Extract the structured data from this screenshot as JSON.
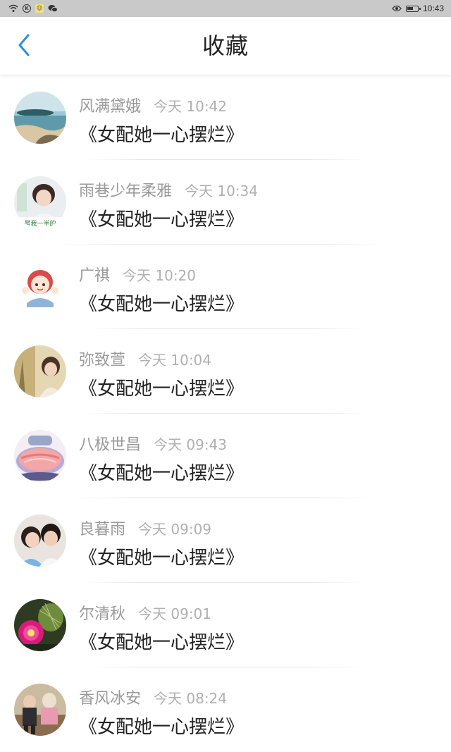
{
  "status_bar": {
    "time": "10:43",
    "left_icons": [
      "wifi-icon",
      "k-icon",
      "notification-icon",
      "wechat-icon"
    ],
    "right_icons": [
      "eye-icon",
      "battery-icon"
    ]
  },
  "header": {
    "title": "收藏",
    "back_icon": "chevron-left-icon",
    "accent_color": "#2b8fe0"
  },
  "items": [
    {
      "user": "风满黛娥",
      "time": "今天 10:42",
      "book": "《女配她一心摆烂》"
    },
    {
      "user": "雨巷少年柔雅",
      "time": "今天 10:34",
      "book": "《女配她一心摆烂》",
      "avatar_text": "是我一半的"
    },
    {
      "user": "广祺",
      "time": "今天 10:20",
      "book": "《女配她一心摆烂》"
    },
    {
      "user": "弥致萱",
      "time": "今天 10:04",
      "book": "《女配她一心摆烂》"
    },
    {
      "user": "八极世昌",
      "time": "今天 09:43",
      "book": "《女配她一心摆烂》"
    },
    {
      "user": "良暮雨",
      "time": "今天 09:09",
      "book": "《女配她一心摆烂》"
    },
    {
      "user": "尔清秋",
      "time": "今天 09:01",
      "book": "《女配她一心摆烂》"
    },
    {
      "user": "香风冰安",
      "time": "今天 08:24",
      "book": "《女配她一心摆烂》"
    }
  ]
}
